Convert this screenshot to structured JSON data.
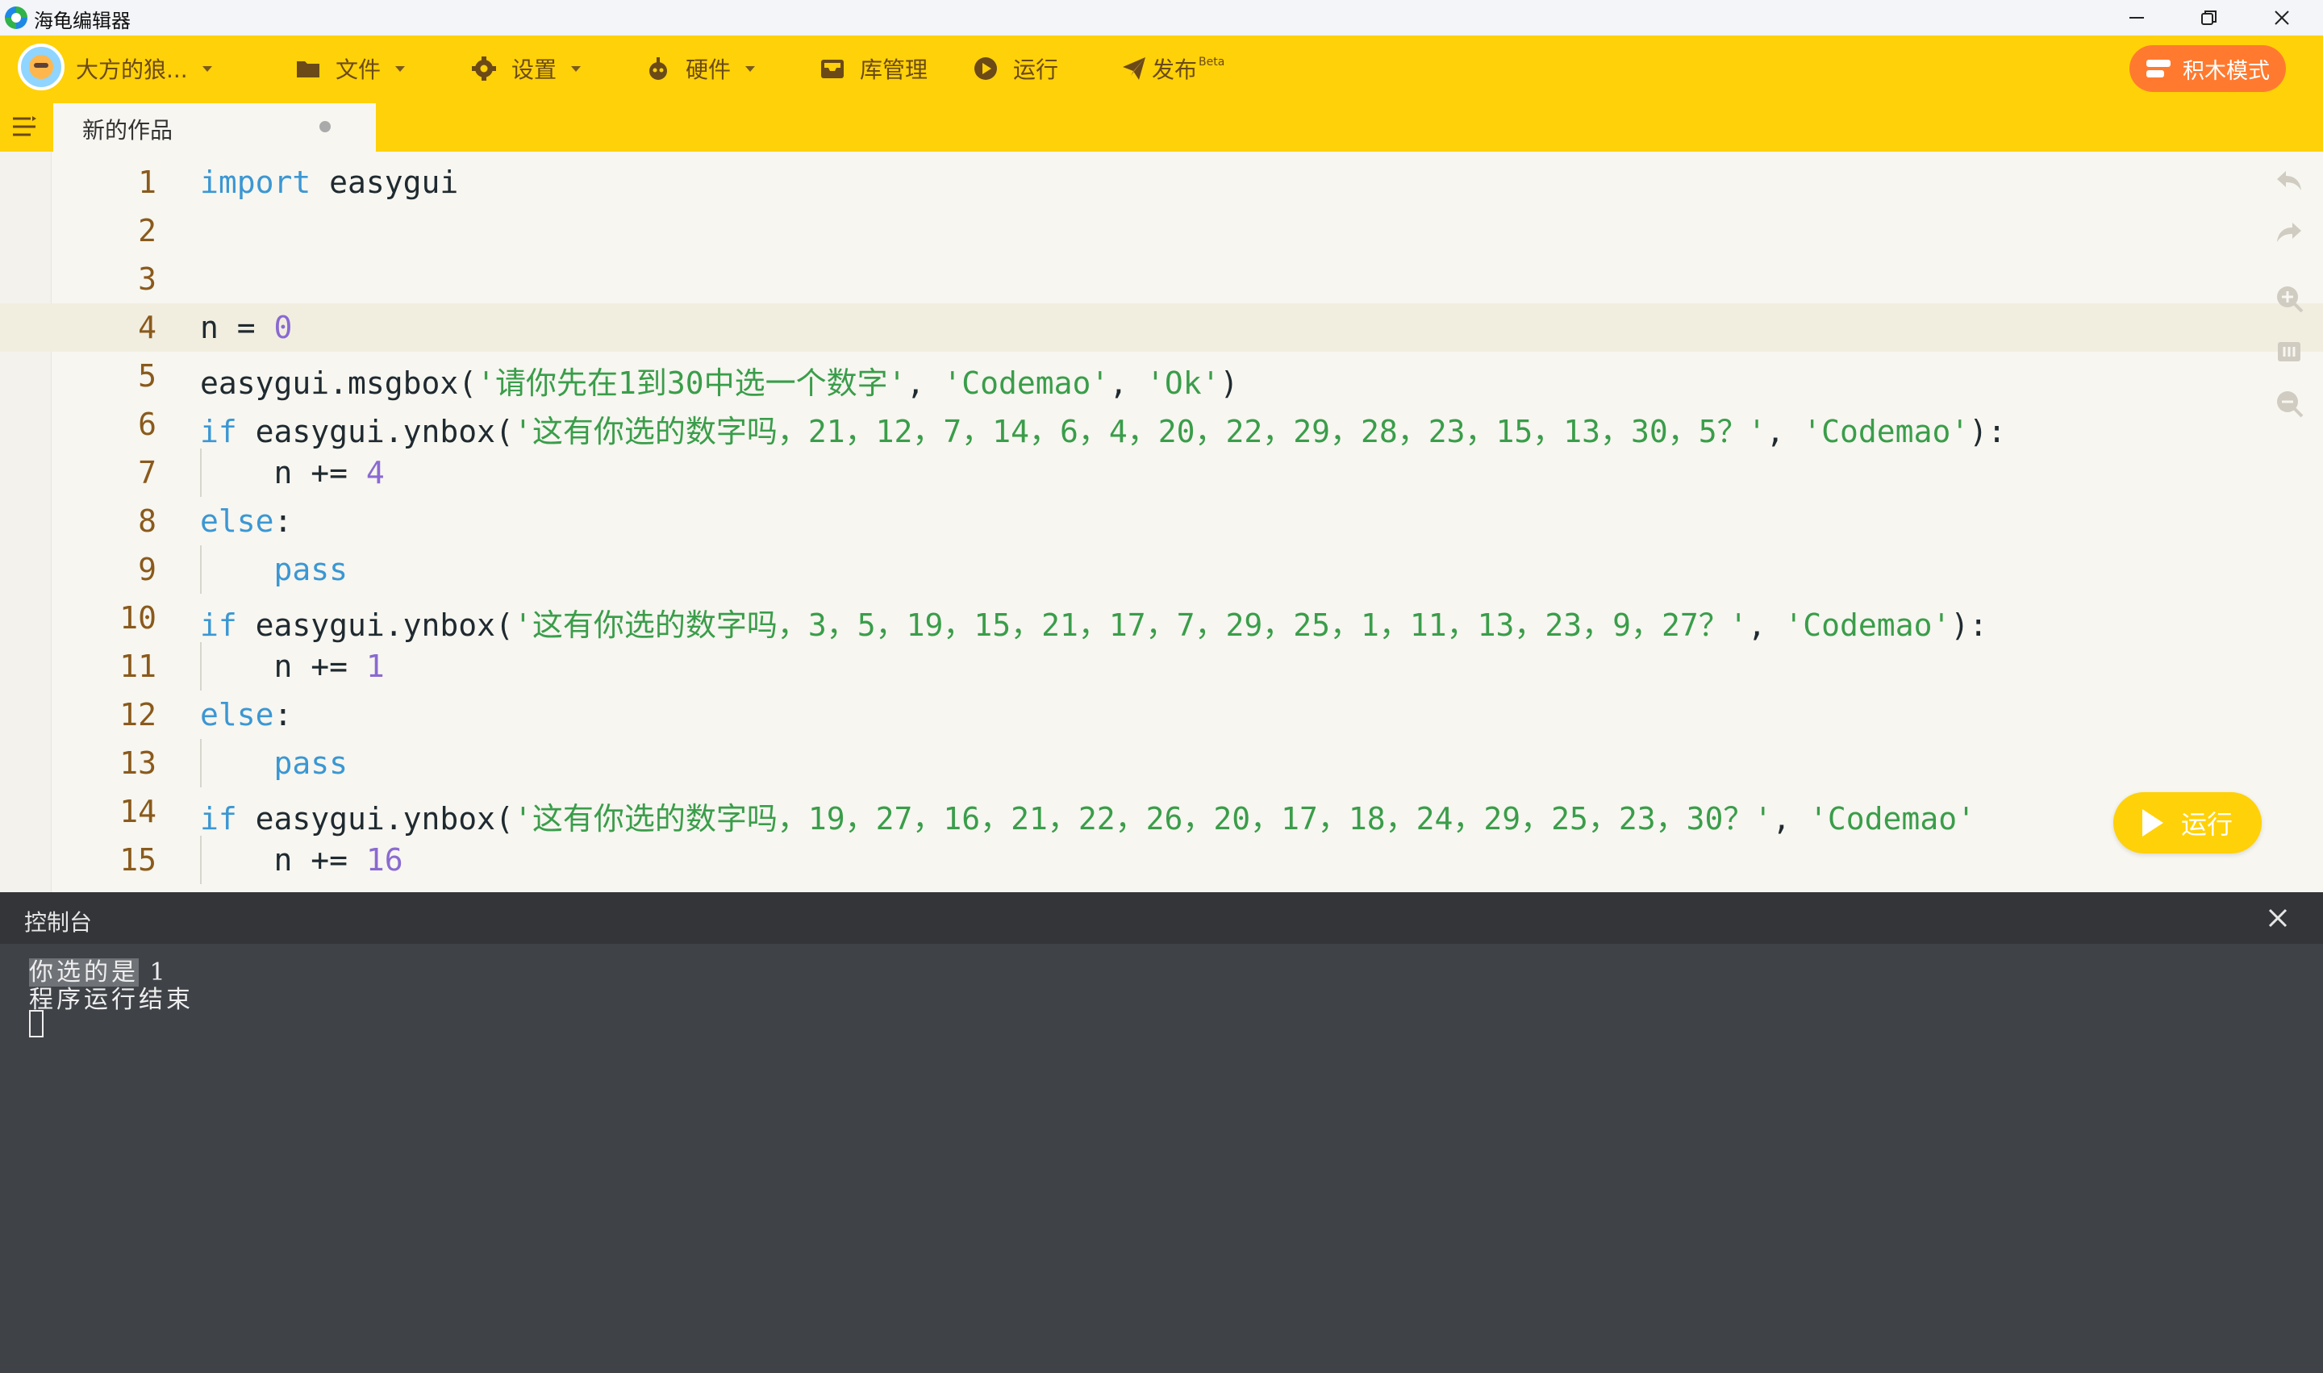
{
  "window": {
    "title": "海龟编辑器",
    "min_icon": "minimize-icon",
    "max_icon": "restore-icon",
    "close_icon": "close-icon"
  },
  "toolbar": {
    "user_name": "大方的狼...",
    "file_label": "文件",
    "settings_label": "设置",
    "hardware_label": "硬件",
    "library_label": "库管理",
    "run_label": "运行",
    "publish_label": "发布",
    "publish_badge": "Beta",
    "block_mode_label": "积木模式"
  },
  "tabs": [
    {
      "label": "新的作品",
      "modified": true
    }
  ],
  "editor": {
    "current_line": 4,
    "lines": [
      {
        "n": "1",
        "tokens": [
          {
            "t": "import",
            "c": "kw"
          },
          {
            "t": " easygui",
            "c": ""
          }
        ]
      },
      {
        "n": "2",
        "tokens": []
      },
      {
        "n": "3",
        "tokens": []
      },
      {
        "n": "4",
        "tokens": [
          {
            "t": "n = ",
            "c": ""
          },
          {
            "t": "0",
            "c": "num"
          }
        ]
      },
      {
        "n": "5",
        "tokens": [
          {
            "t": "easygui.msgbox(",
            "c": ""
          },
          {
            "t": "'请你先在1到30中选一个数字'",
            "c": "str"
          },
          {
            "t": ", ",
            "c": ""
          },
          {
            "t": "'Codemao'",
            "c": "str"
          },
          {
            "t": ", ",
            "c": ""
          },
          {
            "t": "'Ok'",
            "c": "str"
          },
          {
            "t": ")",
            "c": ""
          }
        ]
      },
      {
        "n": "6",
        "tokens": [
          {
            "t": "if",
            "c": "kw"
          },
          {
            "t": " easygui.ynbox(",
            "c": ""
          },
          {
            "t": "'这有你选的数字吗，21，12，7，14，6，4，20，22，29，28，23，15，13，30，5？'",
            "c": "str"
          },
          {
            "t": ", ",
            "c": ""
          },
          {
            "t": "'Codemao'",
            "c": "str"
          },
          {
            "t": "):",
            "c": ""
          }
        ]
      },
      {
        "n": "7",
        "indent": true,
        "tokens": [
          {
            "t": "    n += ",
            "c": ""
          },
          {
            "t": "4",
            "c": "num"
          }
        ]
      },
      {
        "n": "8",
        "tokens": [
          {
            "t": "else",
            "c": "kw"
          },
          {
            "t": ":",
            "c": ""
          }
        ]
      },
      {
        "n": "9",
        "indent": true,
        "tokens": [
          {
            "t": "    ",
            "c": ""
          },
          {
            "t": "pass",
            "c": "kw"
          }
        ]
      },
      {
        "n": "10",
        "tokens": [
          {
            "t": "if",
            "c": "kw"
          },
          {
            "t": " easygui.ynbox(",
            "c": ""
          },
          {
            "t": "'这有你选的数字吗，3，5，19，15，21，17，7，29，25，1，11，13，23，9，27？'",
            "c": "str"
          },
          {
            "t": ", ",
            "c": ""
          },
          {
            "t": "'Codemao'",
            "c": "str"
          },
          {
            "t": "):",
            "c": ""
          }
        ]
      },
      {
        "n": "11",
        "indent": true,
        "tokens": [
          {
            "t": "    n += ",
            "c": ""
          },
          {
            "t": "1",
            "c": "num"
          }
        ]
      },
      {
        "n": "12",
        "tokens": [
          {
            "t": "else",
            "c": "kw"
          },
          {
            "t": ":",
            "c": ""
          }
        ]
      },
      {
        "n": "13",
        "indent": true,
        "tokens": [
          {
            "t": "    ",
            "c": ""
          },
          {
            "t": "pass",
            "c": "kw"
          }
        ]
      },
      {
        "n": "14",
        "tokens": [
          {
            "t": "if",
            "c": "kw"
          },
          {
            "t": " easygui.ynbox(",
            "c": ""
          },
          {
            "t": "'这有你选的数字吗，19，27，16，21，22，26，20，17，18，24，29，25，23，30？'",
            "c": "str"
          },
          {
            "t": ", ",
            "c": ""
          },
          {
            "t": "'Codemao'",
            "c": "str"
          }
        ]
      },
      {
        "n": "15",
        "indent": true,
        "tokens": [
          {
            "t": "    n += ",
            "c": ""
          },
          {
            "t": "16",
            "c": "num"
          }
        ]
      }
    ],
    "side_icons": [
      "undo-icon",
      "redo-icon",
      "zoom-in-icon",
      "format-icon",
      "zoom-out-icon"
    ],
    "run_button_label": "运行"
  },
  "console": {
    "title": "控制台",
    "output": [
      {
        "text": "你选的是",
        "selected": true,
        "suffix": " 1"
      },
      {
        "text": "程序运行结束",
        "selected": false,
        "suffix": ""
      }
    ]
  },
  "colors": {
    "toolbar_bg": "#ffd108",
    "block_mode_bg": "#ff7a2f",
    "keyword": "#3b97d3",
    "string": "#3a9d4a",
    "number": "#8a6ad1",
    "console_bg": "#3f4348"
  }
}
